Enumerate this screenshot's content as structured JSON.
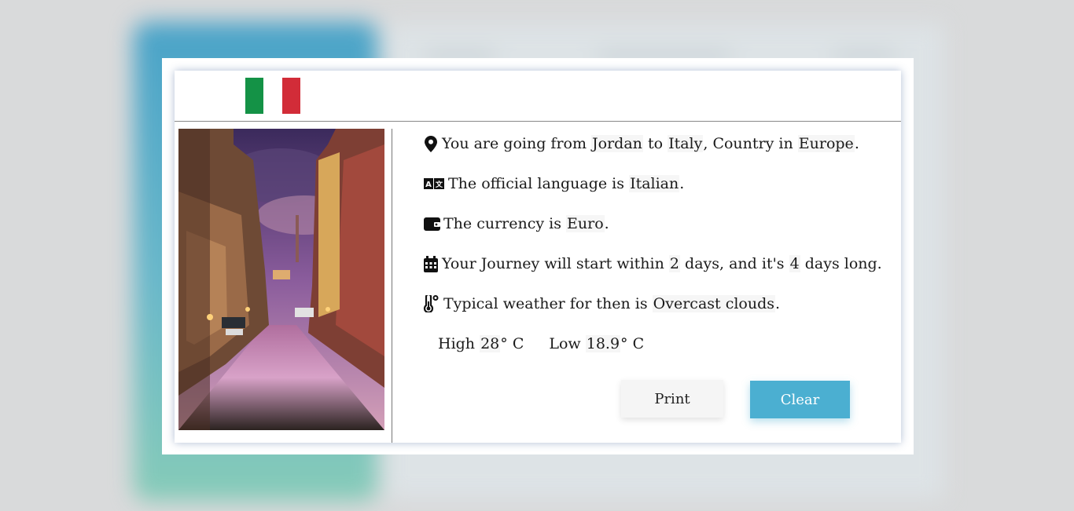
{
  "flag": {
    "colors": [
      "#149246",
      "#ffffff",
      "#d22c38"
    ]
  },
  "trip": {
    "from_prefix": "You are going from",
    "origin": "Jordan",
    "to_word": "to",
    "destination": "Italy",
    "country_in": ", Country in",
    "continent": "Europe",
    "period": "."
  },
  "language": {
    "prefix": "The official language is",
    "value": "Italian",
    "suffix": "."
  },
  "currency": {
    "prefix": "The currency is",
    "value": "Euro",
    "suffix": "."
  },
  "journey": {
    "prefix": "Your Journey will start within",
    "start_days": "2",
    "middle": "days, and it's",
    "length_days": "4",
    "suffix": "days long."
  },
  "weather": {
    "prefix": "Typical weather for then is",
    "value": "Overcast clouds",
    "suffix": ".",
    "high_label": "High",
    "high_value": "28",
    "low_label": "Low",
    "low_value": "18.9",
    "unit": "° C"
  },
  "buttons": {
    "print": "Print",
    "clear": "Clear"
  },
  "icons": {
    "location": "map-pin-icon",
    "language": "language-icon",
    "currency": "wallet-icon",
    "journey": "calendar-icon",
    "weather": "thermometer-icon"
  },
  "colors": {
    "accent": "#4bafd1"
  }
}
